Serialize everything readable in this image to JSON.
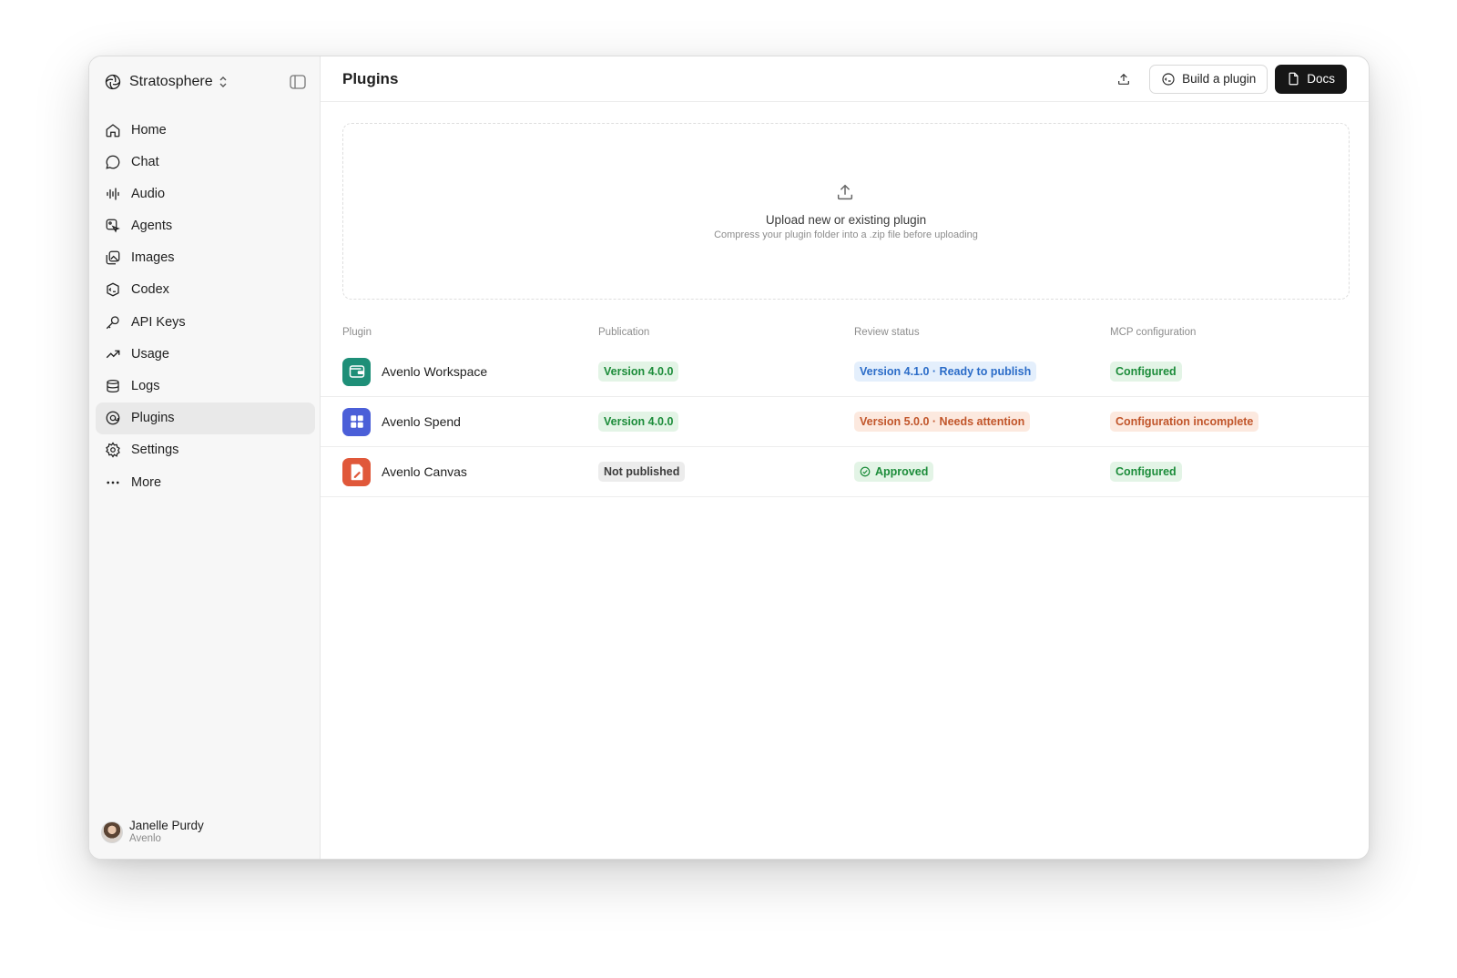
{
  "workspace": {
    "name": "Stratosphere",
    "logo_icon": "stratosphere-logo-icon"
  },
  "sidebar": {
    "items": [
      {
        "label": "Home",
        "icon": "home-icon"
      },
      {
        "label": "Chat",
        "icon": "chat-bubble-icon"
      },
      {
        "label": "Audio",
        "icon": "audio-waveform-icon"
      },
      {
        "label": "Agents",
        "icon": "agents-icon"
      },
      {
        "label": "Images",
        "icon": "images-icon"
      },
      {
        "label": "Codex",
        "icon": "codex-icon"
      },
      {
        "label": "API Keys",
        "icon": "key-icon"
      },
      {
        "label": "Usage",
        "icon": "trending-up-icon"
      },
      {
        "label": "Logs",
        "icon": "logs-icon"
      },
      {
        "label": "Plugins",
        "icon": "plugins-icon",
        "active": true
      },
      {
        "label": "Settings",
        "icon": "gear-icon"
      },
      {
        "label": "More",
        "icon": "more-dots-icon"
      }
    ],
    "user": {
      "name": "Janelle Purdy",
      "org": "Avenlo"
    }
  },
  "header": {
    "title": "Plugins",
    "build_label": "Build a plugin",
    "docs_label": "Docs"
  },
  "upload": {
    "title": "Upload new or existing plugin",
    "subtitle": "Compress your plugin folder into a .zip file before uploading"
  },
  "table": {
    "columns": [
      "Plugin",
      "Publication",
      "Review status",
      "MCP configuration"
    ],
    "rows": [
      {
        "name": "Avenlo Workspace",
        "icon": "wallet-icon",
        "icon_bg": "#1e8f78",
        "publication": "Version 4.0.0",
        "publication_tone": "green",
        "review": "Version 4.1.0 · Ready to publish",
        "review_tone": "blue",
        "mcp": "Configured",
        "mcp_tone": "green"
      },
      {
        "name": "Avenlo Spend",
        "icon": "grid-icon",
        "icon_bg": "#4b5fd8",
        "publication": "Version 4.0.0",
        "publication_tone": "green",
        "review": "Version 5.0.0 · Needs attention",
        "review_tone": "orange",
        "mcp": "Configuration incomplete",
        "mcp_tone": "orange"
      },
      {
        "name": "Avenlo Canvas",
        "icon": "pen-document-icon",
        "icon_bg": "#e0583a",
        "publication": "Not published",
        "publication_tone": "gray",
        "review": "Approved",
        "review_tone": "green",
        "mcp": "Configured",
        "mcp_tone": "green"
      }
    ]
  },
  "colors": {
    "accent_dark": "#161616",
    "green": "#1c8c3a",
    "blue": "#2b6cc8",
    "orange": "#c1552a"
  }
}
